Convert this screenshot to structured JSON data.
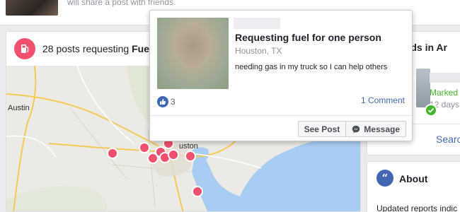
{
  "header": {
    "partial_text": "will share a post with friends."
  },
  "main_card": {
    "title_prefix": "28 posts requesting",
    "title_bold": "Fue",
    "icon": "gas-pump-icon"
  },
  "map": {
    "labels": {
      "austin": "Austin",
      "houston": "uston"
    },
    "pin_color": "#f0506e"
  },
  "popup": {
    "title": "Requesting fuel for one person",
    "location": "Houston, TX",
    "body": "needing gas in my truck so I can help others",
    "like_count": "3",
    "comment_link": "1 Comment",
    "see_post": "See Post",
    "message": "Message"
  },
  "friends_card": {
    "title": "ends in Ar",
    "marked": "Marked",
    "days": "12 days",
    "search": "Searc"
  },
  "about_card": {
    "title": "About",
    "text": "Updated reports indic"
  },
  "colors": {
    "brand_blue": "#4267b2",
    "accent_red": "#f0506e",
    "safe_green": "#42b72a",
    "water": "#a8cdf2"
  }
}
